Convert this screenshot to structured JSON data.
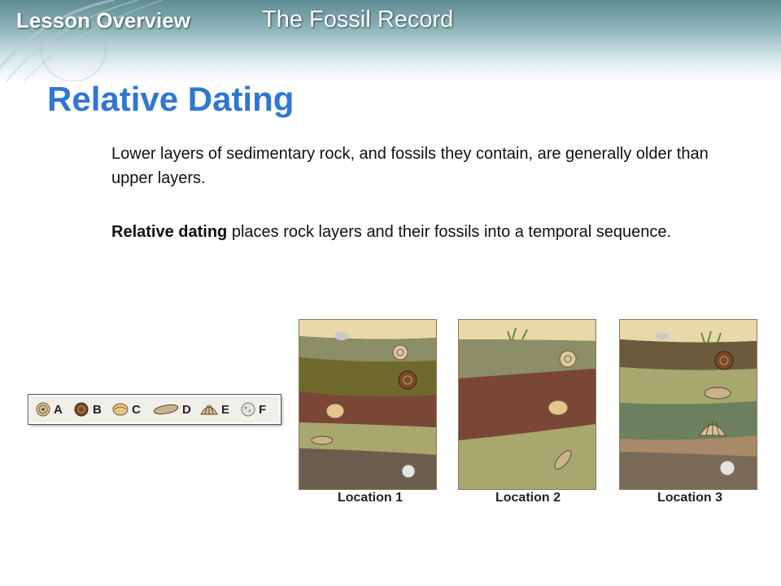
{
  "header": {
    "lesson_label": "Lesson Overview",
    "topic": "The Fossil Record"
  },
  "slide": {
    "title": "Relative Dating",
    "paragraph1": "Lower layers of sedimentary rock, and fossils they contain, are generally older than upper layers.",
    "paragraph2_term": "Relative dating",
    "paragraph2_rest": " places rock layers and their fossils into a temporal sequence."
  },
  "fossil_key": [
    {
      "letter": "A",
      "icon": "spiral-shell-icon"
    },
    {
      "letter": "B",
      "icon": "coiled-shell-icon"
    },
    {
      "letter": "C",
      "icon": "clam-shell-icon"
    },
    {
      "letter": "D",
      "icon": "elongated-shell-icon"
    },
    {
      "letter": "E",
      "icon": "scallop-shell-icon"
    },
    {
      "letter": "F",
      "icon": "round-shell-icon"
    }
  ],
  "locations": [
    {
      "label": "Location 1"
    },
    {
      "label": "Location 2"
    },
    {
      "label": "Location 3"
    }
  ]
}
